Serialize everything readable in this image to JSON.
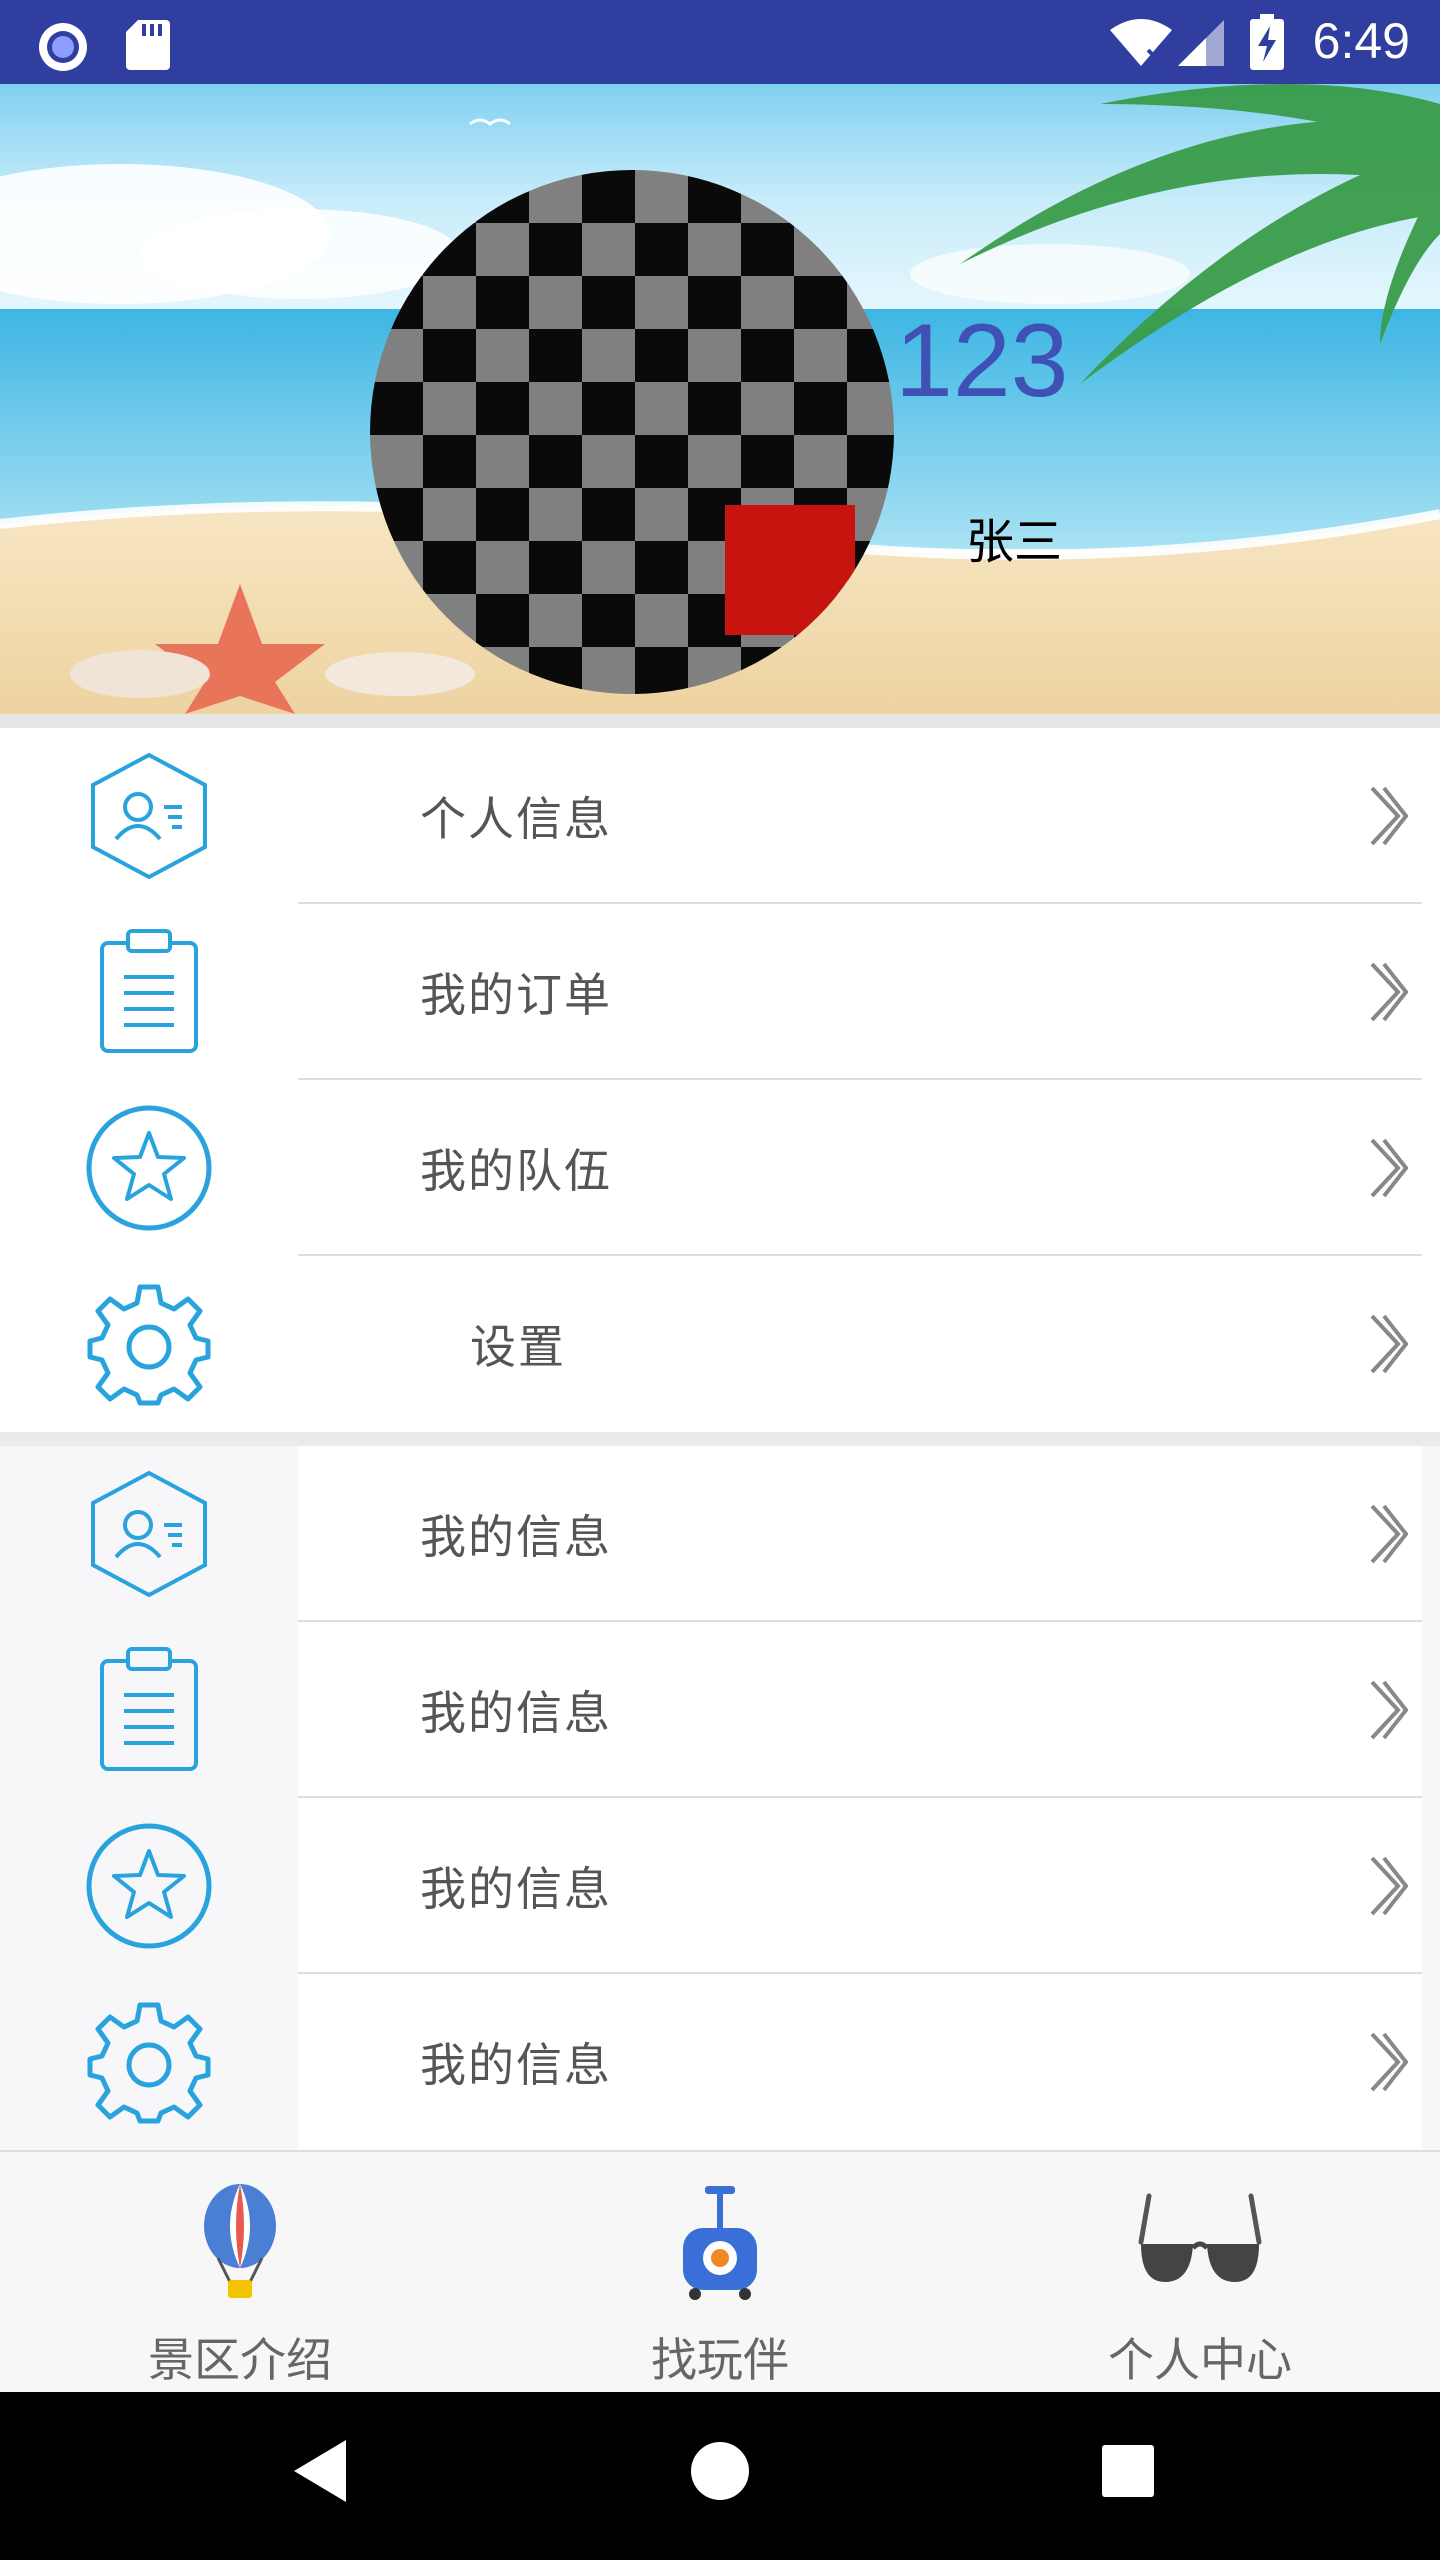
{
  "status_bar": {
    "time": "6:49",
    "icons": [
      "notification-circle-icon",
      "sd-card-icon",
      "wifi-icon",
      "signal-icon",
      "battery-charging-icon"
    ],
    "background": "#303F9F"
  },
  "profile": {
    "number": "123",
    "name": "张三",
    "avatar": "checkerboard-placeholder-image"
  },
  "menu_primary": [
    {
      "label": "个人信息",
      "icon": "user-card-icon"
    },
    {
      "label": "我的订单",
      "icon": "clipboard-icon"
    },
    {
      "label": "我的队伍",
      "icon": "star-circle-icon"
    },
    {
      "label": "设置",
      "icon": "gear-icon"
    }
  ],
  "menu_secondary": [
    {
      "label": "我的信息",
      "icon": "user-card-icon"
    },
    {
      "label": "我的信息",
      "icon": "clipboard-icon"
    },
    {
      "label": "我的信息",
      "icon": "star-circle-icon"
    },
    {
      "label": "我的信息",
      "icon": "gear-icon"
    }
  ],
  "bottom_nav": [
    {
      "label": "景区介绍",
      "icon": "hot-air-balloon-icon"
    },
    {
      "label": "找玩伴",
      "icon": "luggage-icon"
    },
    {
      "label": "个人中心",
      "icon": "sunglasses-icon"
    }
  ],
  "colors": {
    "accent": "#3F51B5",
    "icon_blue": "#29A3DD",
    "avatar_accent": "#C8140F"
  }
}
